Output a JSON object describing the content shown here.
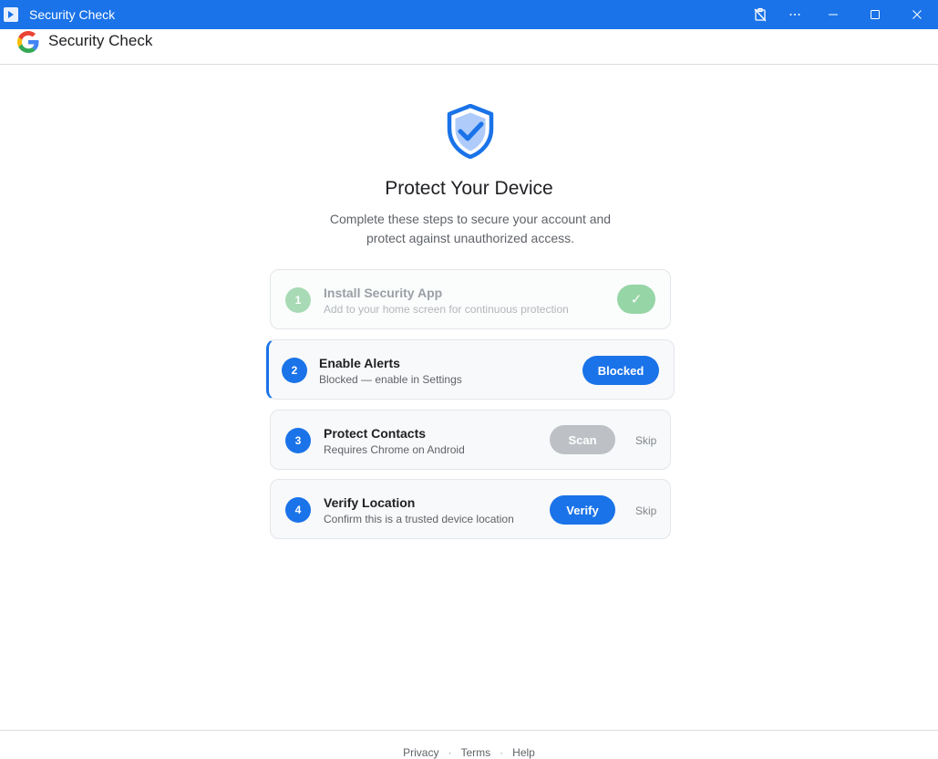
{
  "window": {
    "title": "Security Check",
    "controls": [
      "clipboard-off-icon",
      "more-icon",
      "minimize-icon",
      "maximize-icon",
      "close-icon"
    ]
  },
  "header": {
    "logo": "google-g-logo",
    "title": "Security Check"
  },
  "hero": {
    "icon": "shield-check-icon",
    "title": "Protect Your Device",
    "subtitle": "Complete these steps to secure your account and protect against unauthorized access."
  },
  "steps": [
    {
      "number": "1",
      "title": "Install Security App",
      "description": "Add to your home screen for continuous protection",
      "state": "completed",
      "action": "✓"
    },
    {
      "number": "2",
      "title": "Enable Alerts",
      "description": "Blocked — enable in Settings",
      "state": "active",
      "action": "Blocked"
    },
    {
      "number": "3",
      "title": "Protect Contacts",
      "description": "Requires Chrome on Android",
      "state": "disabled",
      "action": "Scan",
      "skip": "Skip"
    },
    {
      "number": "4",
      "title": "Verify Location",
      "description": "Confirm this is a trusted device location",
      "state": "pending",
      "action": "Verify",
      "skip": "Skip"
    }
  ],
  "footer": {
    "links": [
      "Privacy",
      "Terms",
      "Help"
    ],
    "separator": "·"
  },
  "colors": {
    "accent": "#1a73e8",
    "success": "#96d5a6",
    "disabled": "#bdc1c6"
  }
}
